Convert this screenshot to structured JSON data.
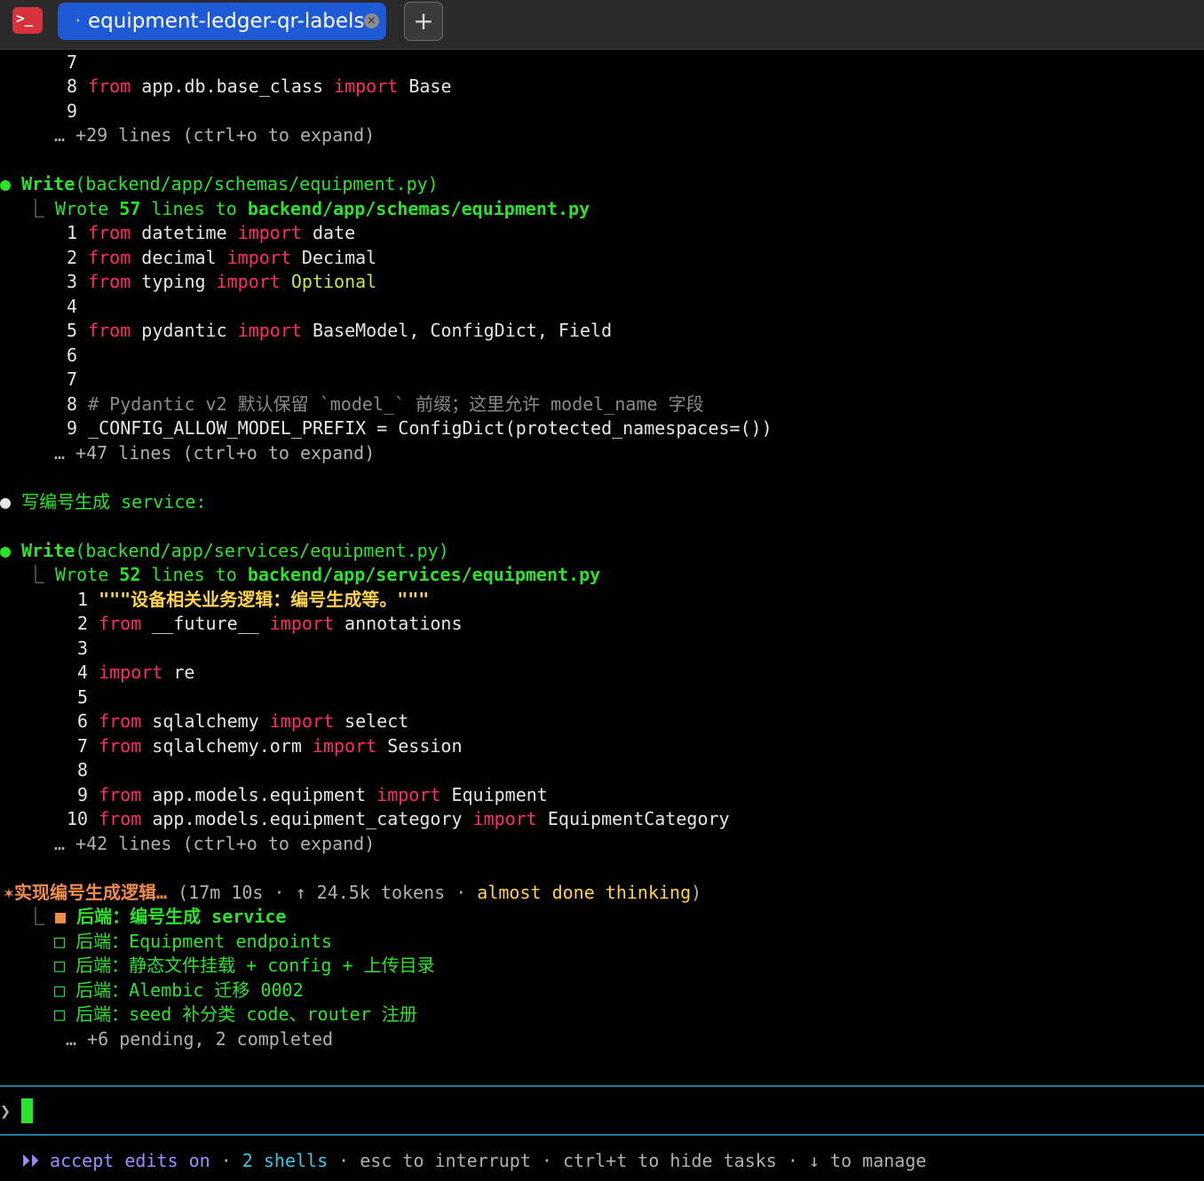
{
  "window": {
    "app_icon": ">_",
    "tab_dot": "·",
    "tab_title": "equipment-ledger-qr-labels",
    "tab_close": "×",
    "new_tab": "+"
  },
  "block1": {
    "l7": "7",
    "l8_num": "8",
    "l8_from": "from",
    "l8_mod": " app.db.base_class ",
    "l8_import": "import",
    "l8_name": " Base",
    "l9": "9",
    "expand": "… +29 lines (ctrl+o to expand)"
  },
  "write1": {
    "bullet": "●",
    "label": "Write",
    "path": "(backend/app/schemas/equipment.py)",
    "branch": "⎿",
    "wrote": " Wrote ",
    "count": "57",
    "lines_to": " lines to ",
    "file": "backend/app/schemas/equipment.py",
    "code": [
      {
        "n": "1",
        "a": "from",
        "b": " datetime ",
        "c": "import",
        "d": " date"
      },
      {
        "n": "2",
        "a": "from",
        "b": " decimal ",
        "c": "import",
        "d": " Decimal"
      },
      {
        "n": "3",
        "a": "from",
        "b": " typing ",
        "c": "import",
        "d": ""
      },
      {
        "n": "4"
      },
      {
        "n": "5",
        "a": "from",
        "b": " pydantic ",
        "c": "import",
        "d": " BaseModel, ConfigDict, Field"
      },
      {
        "n": "6"
      },
      {
        "n": "7"
      }
    ],
    "optional": " Optional",
    "l8_num": "8",
    "comment": "# Pydantic v2 默认保留 `model_` 前缀；这里允许 model_name 字段",
    "l9_num": "9",
    "l9_text": "_CONFIG_ALLOW_MODEL_PREFIX = ConfigDict(protected_namespaces=())",
    "expand": "… +47 lines (ctrl+o to expand)"
  },
  "note": {
    "bullet": "●",
    "text": "写编号生成 service:"
  },
  "write2": {
    "bullet": "●",
    "label": "Write",
    "path": "(backend/app/services/equipment.py)",
    "branch": "⎿",
    "wrote": " Wrote ",
    "count": "52",
    "lines_to": " lines to ",
    "file": "backend/app/services/equipment.py",
    "docstring": "\"\"\"设备相关业务逻辑：编号生成等。\"\"\"",
    "l2_from": "from",
    "l2_mod": " __future__ ",
    "l2_import": "import",
    "l2_name": " annotations",
    "l4_import": "import",
    "l4_name": " re",
    "l6_from": "from",
    "l6_mod": " sqlalchemy ",
    "l6_import": "import",
    "l6_name": " select",
    "l7_from": "from",
    "l7_mod": " sqlalchemy.orm ",
    "l7_import": "import",
    "l7_name": " Session",
    "l9_from": "from",
    "l9_mod": " app.models.equipment ",
    "l9_import": "import",
    "l9_name": " Equipment",
    "l10_from": "from",
    "l10_mod": " app.models.equipment_category ",
    "l10_import": "import",
    "l10_name": " EquipmentCategory",
    "nums": [
      "1",
      "2",
      "3",
      "4",
      "5",
      "6",
      "7",
      "8",
      "9",
      "10"
    ],
    "expand": "… +42 lines (ctrl+o to expand)"
  },
  "status": {
    "star": "✶",
    "task": "实现编号生成逻辑…",
    "paren_open": " (17m 10s · ↑ 24.5k tokens · ",
    "thinking": "almost done thinking",
    "paren_close": ")"
  },
  "todos": {
    "branch": "⎿",
    "active_box": "■",
    "active": "后端：编号生成 service",
    "items": [
      "后端：Equipment endpoints",
      "后端：静态文件挂载 + config + 上传目录",
      "后端：Alembic 迁移 0002",
      "后端：seed 补分类 code、router 注册"
    ],
    "box": "□",
    "more": "… +6 pending, 2 completed"
  },
  "prompt": {
    "symbol": "❯"
  },
  "footer": {
    "arrows": "⏵⏵",
    "accept": " accept edits on",
    "dot1": " · ",
    "shells": "2 shells",
    "rest": " · esc to interrupt · ctrl+t to hide tasks · ↓ to manage"
  },
  "colors": {
    "accent": "#1e5ad6",
    "green": "#2ce32c",
    "keyword": "#ff2b6b",
    "separator": "#1a7ea0"
  }
}
